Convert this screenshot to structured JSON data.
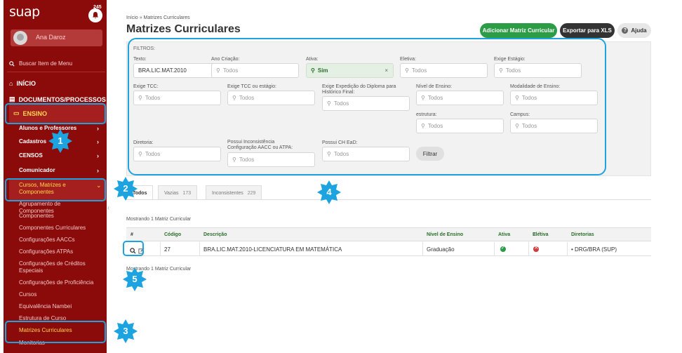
{
  "sidebar": {
    "logo": "suap",
    "notifications": "245",
    "user_name": "Ana Daroz",
    "search_label": "Buscar Item de Menu",
    "items": {
      "inicio": "INÍCIO",
      "documentos": "DOCUMENTOS/PROCESSOS",
      "ensino": "ENSINO",
      "alunos": "Alunos e Professores",
      "cadastros": "Cadastros",
      "censos": "CENSOS",
      "comunicador": "Comunicador",
      "cursos": "Cursos, Matrizes e Componentes"
    },
    "leaves": [
      "Agrupamento de Componentes",
      "Componentes",
      "Componentes Curriculares",
      "Configurações AACCs",
      "Configurações ATPAs",
      "Configurações de Créditos Especiais",
      "Configurações de Proficiência",
      "Cursos",
      "Equivalência Nambei",
      "Estrutura de Curso",
      "Matrizes Curriculares",
      "Monitorias"
    ]
  },
  "header": {
    "breadcrumb_home": "Início",
    "breadcrumb_sep": "»",
    "breadcrumb_current": "Matrizes Curriculares",
    "title": "Matrizes Curriculares",
    "btn_add": "Adicionar Matriz Curricular",
    "btn_export": "Exportar para XLS",
    "btn_help": "Ajuda"
  },
  "filters": {
    "title": "FILTROS:",
    "placeholder": "Todos",
    "texto_label": "Texto:",
    "texto_value": "BRA.LIC.MAT.2010",
    "ano_label": "Ano Criação:",
    "ativa_label": "Ativa:",
    "ativa_value": "Sim",
    "eletiva_label": "Eletiva:",
    "estagio_label": "Exige Estágio:",
    "tcc_label": "Exige TCC:",
    "tcc_estagio_label": "Exige TCC ou estágio:",
    "diploma_label": "Exige Expedição do Diploma para Histórico Final:",
    "nivel_label": "Nível de Ensino:",
    "modalidade_label": "Modalidade de Ensino:",
    "estrutura_label": "estrutura:",
    "campus_label": "Campus:",
    "diretoria_label": "Diretoria:",
    "inconsistencia_label": "Possui Inconsistência Configuração AACC ou ATPA:",
    "ead_label": "Possui CH EaD:",
    "filtrar": "Filtrar"
  },
  "tabs": [
    {
      "label": "Todos",
      "count": ""
    },
    {
      "label": "Vazias",
      "count": "173"
    },
    {
      "label": "Inconsistentes",
      "count": "229"
    }
  ],
  "table": {
    "showing_top": "Mostrando 1 Matriz Curricular",
    "showing_bottom": "Mostrando 1 Matriz Curricular",
    "headers": [
      "#",
      "Código",
      "Descrição",
      "Nível de Ensino",
      "Ativa",
      "Eletiva",
      "Diretorias"
    ],
    "rows": [
      {
        "codigo": "27",
        "descricao": "BRA.LIC.MAT.2010-LICENCIATURA EM MATEMÁTICA",
        "nivel": "Graduação",
        "diretoria": "DRG/BRA (SUP)"
      }
    ]
  },
  "callouts": [
    "1",
    "2",
    "3",
    "4",
    "5"
  ],
  "colors": {
    "sidebar": "#8b0a0a",
    "highlight": "#1ca3e0",
    "accent_green": "#2c9d46"
  }
}
